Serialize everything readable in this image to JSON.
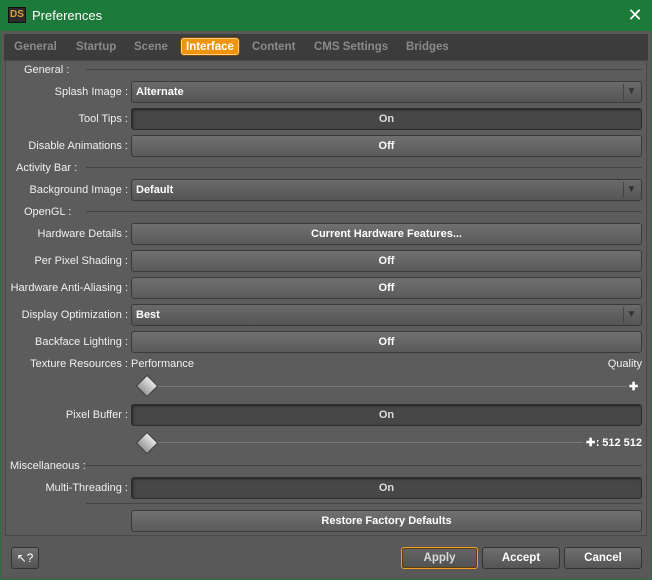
{
  "window": {
    "app_icon_text": "DS",
    "title": "Preferences",
    "close_glyph": "✕"
  },
  "tabs": [
    {
      "label": "General",
      "active": false
    },
    {
      "label": "Startup",
      "active": false
    },
    {
      "label": "Scene",
      "active": false
    },
    {
      "label": "Interface",
      "active": true
    },
    {
      "label": "Content",
      "active": false
    },
    {
      "label": "CMS Settings",
      "active": false
    },
    {
      "label": "Bridges",
      "active": false
    }
  ],
  "sections": {
    "general": "General :",
    "activity_bar": "Activity Bar :",
    "opengl": "OpenGL :",
    "misc": "Miscellaneous :"
  },
  "general": {
    "splash_image": {
      "label": "Splash Image :",
      "value": "Alternate"
    },
    "tool_tips": {
      "label": "Tool Tips :",
      "value": "On"
    },
    "disable_animations": {
      "label": "Disable Animations :",
      "value": "Off"
    }
  },
  "activity_bar": {
    "background_image": {
      "label": "Background Image :",
      "value": "Default"
    }
  },
  "opengl": {
    "hardware_details": {
      "label": "Hardware Details :",
      "value": "Current Hardware Features..."
    },
    "per_pixel_shading": {
      "label": "Per Pixel Shading :",
      "value": "Off"
    },
    "anti_aliasing": {
      "label": "Hardware Anti-Aliasing :",
      "value": "Off"
    },
    "display_optimization": {
      "label": "Display Optimization :",
      "value": "Best"
    },
    "backface_lighting": {
      "label": "Backface Lighting :",
      "value": "Off"
    },
    "texture_resources": {
      "label": "Texture Resources :",
      "min_label": "Performance",
      "max_label": "Quality",
      "level": 0
    },
    "pixel_buffer": {
      "label": "Pixel Buffer :",
      "value": "On",
      "slider_value": "512 x 512",
      "level": 0
    }
  },
  "misc": {
    "multi_threading": {
      "label": "Multi-Threading :",
      "value": "On"
    },
    "restore_defaults": "Restore Factory Defaults"
  },
  "footer": {
    "help_glyph": "↖?",
    "apply": "Apply",
    "accept": "Accept",
    "cancel": "Cancel"
  },
  "icons": {
    "dropdown": "chevron-down-icon",
    "plus": "plus-icon"
  },
  "colors": {
    "titlebar": "#1c7a3a",
    "active_tab": "#f0940c",
    "apply_border": "#f0a020"
  }
}
